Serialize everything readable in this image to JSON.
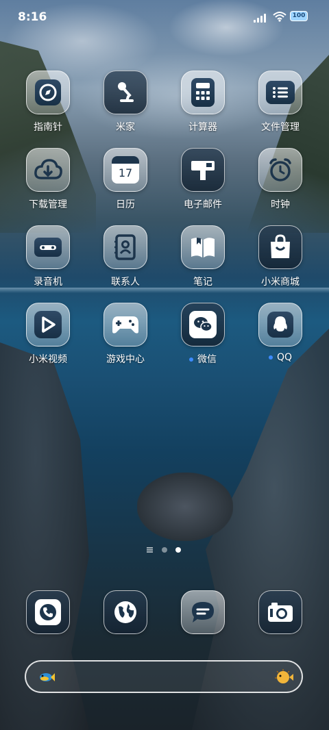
{
  "status_bar": {
    "time": "8:16",
    "battery_text": "100",
    "icons": [
      "signal-icon",
      "wifi-icon",
      "battery-icon"
    ]
  },
  "apps": [
    {
      "label": "指南针",
      "icon": "compass-icon"
    },
    {
      "label": "米家",
      "icon": "mijia-lamp-icon"
    },
    {
      "label": "计算器",
      "icon": "calculator-icon"
    },
    {
      "label": "文件管理",
      "icon": "folder-icon"
    },
    {
      "label": "下载管理",
      "icon": "download-cloud-icon"
    },
    {
      "label": "日历",
      "icon": "calendar-icon",
      "badge_text": "17"
    },
    {
      "label": "电子邮件",
      "icon": "mailbox-icon"
    },
    {
      "label": "时钟",
      "icon": "alarm-clock-icon"
    },
    {
      "label": "录音机",
      "icon": "cassette-icon"
    },
    {
      "label": "联系人",
      "icon": "contacts-icon"
    },
    {
      "label": "笔记",
      "icon": "notebook-icon"
    },
    {
      "label": "小米商城",
      "icon": "shopping-bag-icon"
    },
    {
      "label": "小米视频",
      "icon": "video-play-icon"
    },
    {
      "label": "游戏中心",
      "icon": "gamepad-icon"
    },
    {
      "label": "微信",
      "icon": "wechat-icon",
      "new_dot": true
    },
    {
      "label": "QQ",
      "icon": "qq-penguin-icon",
      "new_dot": true
    }
  ],
  "page_indicator": {
    "pages": 2,
    "current": 2
  },
  "dock": [
    {
      "icon": "phone-icon"
    },
    {
      "icon": "browser-globe-icon"
    },
    {
      "icon": "messages-icon"
    },
    {
      "icon": "camera-icon"
    }
  ],
  "search_bar": {
    "left_icon": "fish-icon",
    "right_icon": "pufferfish-icon"
  },
  "colors": {
    "new_dot": "#3d8bff",
    "glyph_dark": "#1d354c"
  }
}
